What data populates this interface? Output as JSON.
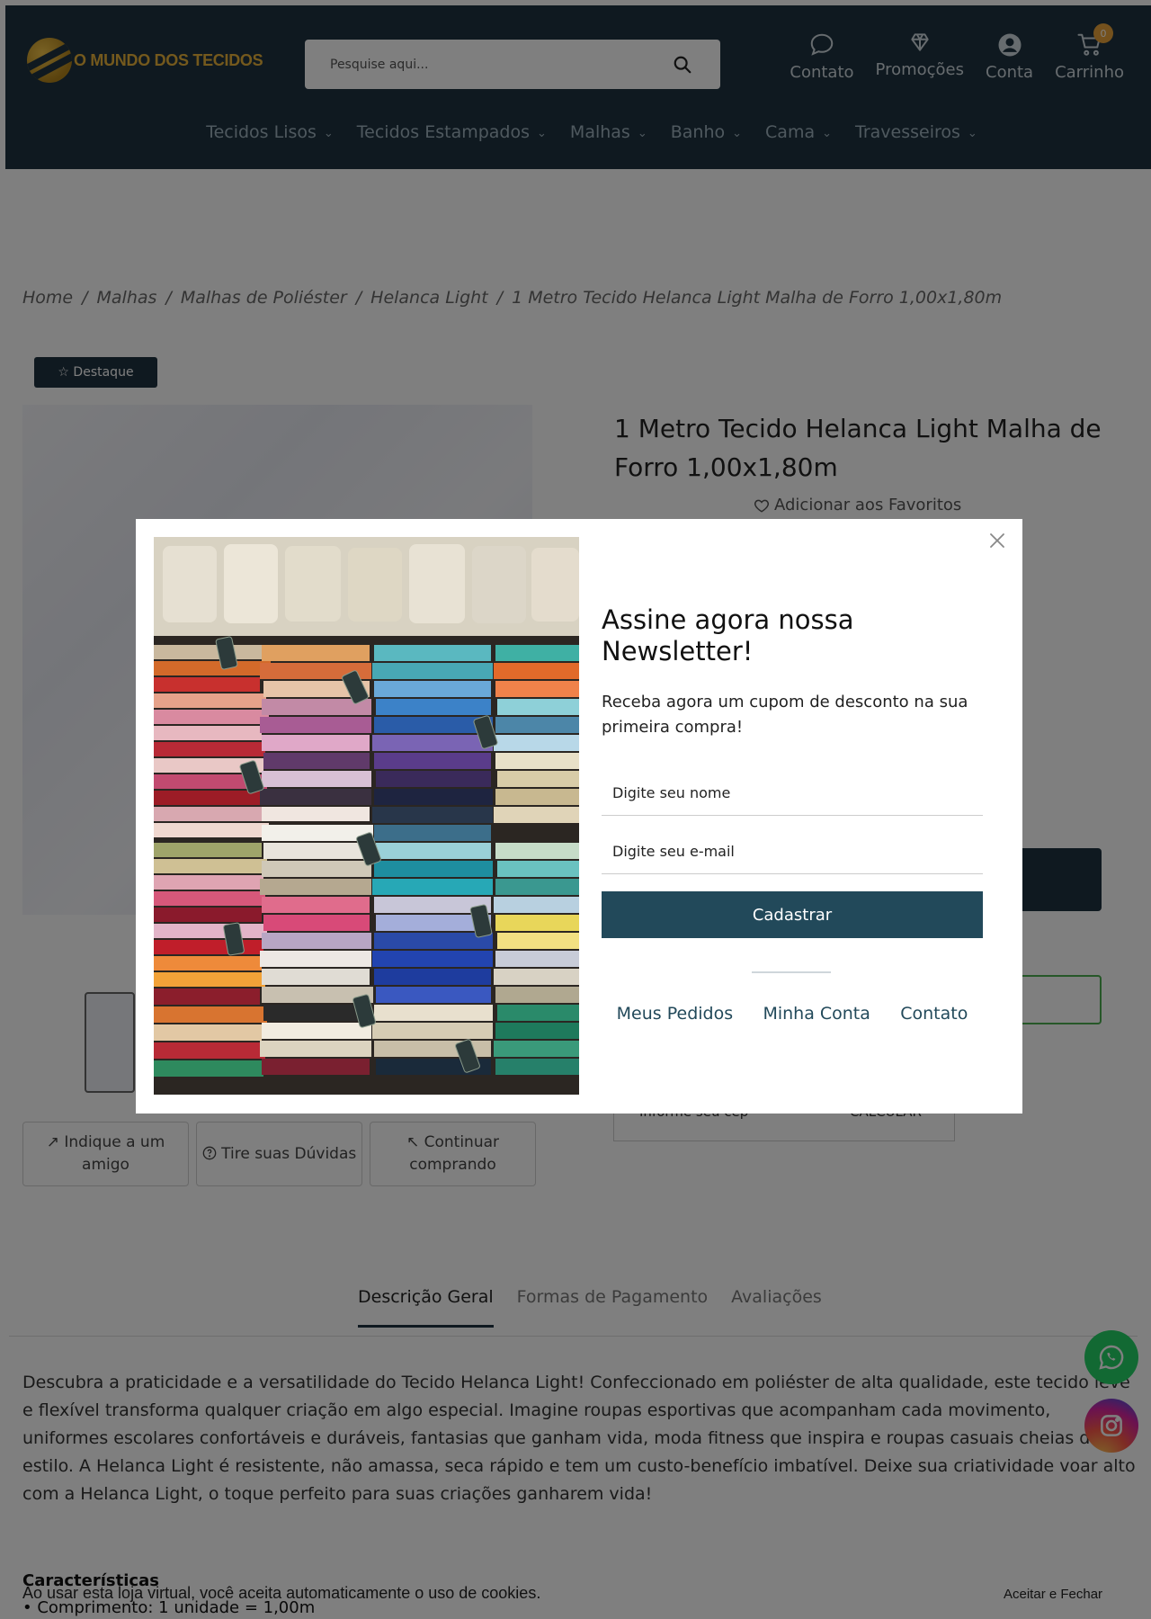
{
  "header": {
    "logo_text": "O MUNDO DOS TECIDOS",
    "search_placeholder": "Pesquise aqui...",
    "links": {
      "contato": "Contato",
      "promocoes": "Promoções",
      "conta": "Conta",
      "carrinho": "Carrinho"
    },
    "cart_count": "0",
    "accent_color": "#e8a23a",
    "background_color": "#1f3340"
  },
  "nav": {
    "items": [
      {
        "label": "Tecidos Lisos",
        "icon": "chevron-down-icon"
      },
      {
        "label": "Tecidos Estampados",
        "icon": "chevron-down-icon"
      },
      {
        "label": "Malhas",
        "icon": "chevron-down-icon"
      },
      {
        "label": "Banho",
        "icon": "chevron-down-icon"
      },
      {
        "label": "Cama",
        "icon": "chevron-down-icon"
      },
      {
        "label": "Travesseiros",
        "icon": "chevron-down-icon"
      }
    ]
  },
  "breadcrumb": {
    "items": [
      "Home",
      "Malhas",
      "Malhas de Poliéster",
      "Helanca Light",
      "1 Metro Tecido Helanca Light Malha de Forro 1,00x1,80m"
    ],
    "separator": "/"
  },
  "product": {
    "badge": "☆ Destaque",
    "title": "1 Metro Tecido Helanca Light Malha de Forro 1,00x1,80m",
    "favorite_label": "Adicionar aos Favoritos",
    "cep_placeholder": "Informe seu cep",
    "cep_button": "CALCULAR"
  },
  "actions": {
    "indique": "↗ Indique a um amigo",
    "duvidas": "Tire suas Dúvidas",
    "continuar": "↖ Continuar comprando"
  },
  "tabs": {
    "items": [
      "Descrição Geral",
      "Formas de Pagamento",
      "Avaliações"
    ],
    "active": "Descrição Geral"
  },
  "description": {
    "text": "Descubra a praticidade e a versatilidade do Tecido Helanca Light! Confeccionado em poliéster de alta qualidade, este tecido leve e flexível transforma qualquer criação em algo especial. Imagine roupas esportivas que acompanham cada movimento, uniformes escolares confortáveis e duráveis, fantasias que ganham vida, moda fitness que inspira e roupas casuais cheias de estilo. A Helanca Light é resistente, não amassa, seca rápido e tem um custo-benefício imbatível. Deixe sua criatividade voar alto com a Helanca Light, o toque perfeito para suas criações ganharem vida!",
    "features_title": "Características",
    "features": [
      "• Comprimento: 1 unidade = 1,00m"
    ]
  },
  "cookie": {
    "text": "Ao usar esta loja virtual, você aceita automaticamente o uso de cookies.",
    "button": "Aceitar e Fechar"
  },
  "newsletter": {
    "title": "Assine agora nossa Newsletter!",
    "subtitle": "Receba agora um cupom de desconto na sua primeira compra!",
    "name_placeholder": "Digite seu nome",
    "email_placeholder": "Digite seu e-mail",
    "submit": "Cadastrar",
    "links": [
      "Meus Pedidos",
      "Minha Conta",
      "Contato"
    ],
    "button_color": "#22495a"
  },
  "floating": {
    "whatsapp_icon": "whatsapp-icon",
    "instagram_icon": "instagram-icon"
  }
}
